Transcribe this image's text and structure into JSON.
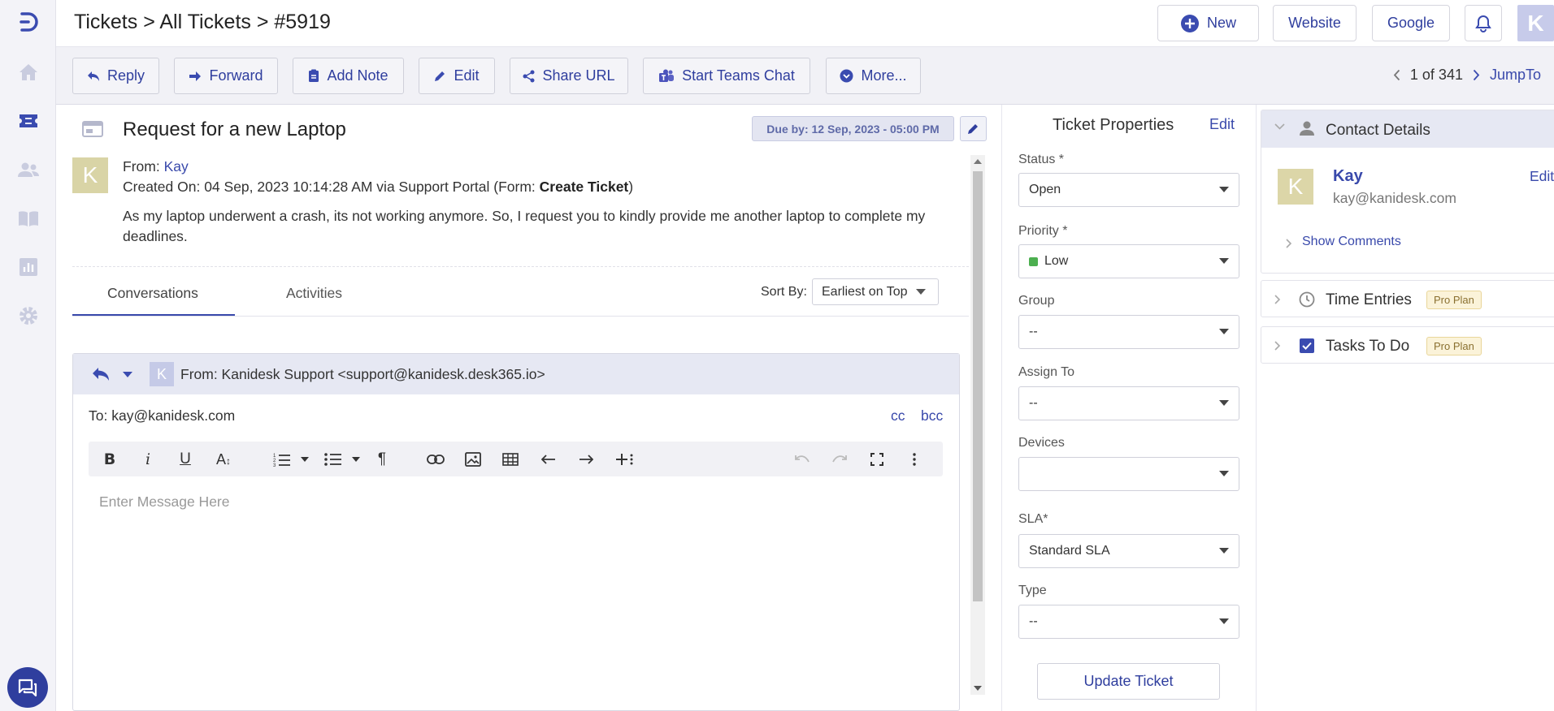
{
  "header": {
    "breadcrumb": "Tickets > All Tickets > #5919",
    "new_label": "New",
    "website_label": "Website",
    "google_label": "Google",
    "avatar_initial": "K"
  },
  "toolbar": {
    "reply": "Reply",
    "forward": "Forward",
    "add_note": "Add Note",
    "edit": "Edit",
    "share_url": "Share URL",
    "teams_chat": "Start Teams Chat",
    "more": "More...",
    "pager_count": "1 of 341",
    "jump_to": "JumpTo"
  },
  "ticket": {
    "title": "Request for a new Laptop",
    "due": "Due by: 12 Sep, 2023 - 05:00 PM",
    "avatar_initial": "K",
    "from_label": "From:",
    "from_name": "Kay",
    "created_prefix": "Created On: 04 Sep, 2023 10:14:28 AM via Support Portal (Form: ",
    "created_form": "Create Ticket",
    "created_suffix": ")",
    "description": "As my laptop underwent a crash, its not working anymore. So, I request you to kindly provide me another laptop to complete my deadlines."
  },
  "conversation": {
    "tabs": [
      "Conversations",
      "Activities"
    ],
    "sort_label": "Sort By:",
    "sort_value": "Earliest on Top"
  },
  "reply": {
    "avatar_initial": "K",
    "from": "From:  Kanidesk Support <support@kanidesk.desk365.io>",
    "to": "To: kay@kanidesk.com",
    "cc": "cc",
    "bcc": "bcc",
    "placeholder": "Enter Message Here"
  },
  "properties": {
    "title": "Ticket Properties",
    "edit": "Edit",
    "fields": [
      {
        "label": "Status *",
        "value": "Open"
      },
      {
        "label": "Priority *",
        "value": "Low"
      },
      {
        "label": "Group",
        "value": "--"
      },
      {
        "label": "Assign To",
        "value": "--"
      },
      {
        "label": "Devices",
        "value": ""
      },
      {
        "label": "SLA*",
        "value": "Standard SLA"
      },
      {
        "label": "Type",
        "value": "--"
      }
    ],
    "priority_color": "#4caf50",
    "update_button": "Update Ticket"
  },
  "contact": {
    "title": "Contact Details",
    "avatar_initial": "K",
    "name": "Kay",
    "email": "kay@kanidesk.com",
    "edit": "Edit",
    "show_comments": "Show Comments"
  },
  "accordions": {
    "time_entries": "Time Entries",
    "tasks": "Tasks To Do",
    "pro_badge": "Pro Plan"
  },
  "colors": {
    "accent": "#2f3e9e",
    "link": "#3949ab"
  }
}
